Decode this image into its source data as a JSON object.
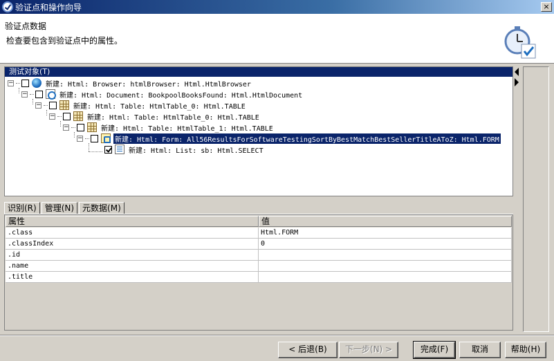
{
  "window": {
    "title": "验证点和操作向导",
    "close_label": "×"
  },
  "header": {
    "title": "验证点数据",
    "description": "检查要包含到验证点中的属性。",
    "icon": "stopwatch-check-icon"
  },
  "tree": {
    "header": "测试对象(T)",
    "nodes": [
      {
        "label": "新建: Html: Browser: htmlBrowser: Html.HtmlBrowser",
        "icon": "globe-icon",
        "checked": false,
        "selected": false
      },
      {
        "label": "新建: Html: Document: BookpoolBooksFound: Html.HtmlDocument",
        "icon": "document-icon",
        "checked": false,
        "selected": false
      },
      {
        "label": "新建: Html: Table: HtmlTable_0: Html.TABLE",
        "icon": "table-icon",
        "checked": false,
        "selected": false
      },
      {
        "label": "新建: Html: Table: HtmlTable_0: Html.TABLE",
        "icon": "table-icon",
        "checked": false,
        "selected": false
      },
      {
        "label": "新建: Html: Table: HtmlTable_1: Html.TABLE",
        "icon": "table-icon",
        "checked": false,
        "selected": false
      },
      {
        "label": "新建: Html: Form: All56ResultsForSoftwareTestingSortByBestMatchBestSellerTitleAToZ: Html.FORM",
        "icon": "form-icon",
        "checked": false,
        "selected": true
      },
      {
        "label": "新建: Html: List: sb: Html.SELECT",
        "icon": "list-icon",
        "checked": true,
        "selected": false
      }
    ]
  },
  "tabs": [
    {
      "label": "识别(R)",
      "active": true
    },
    {
      "label": "管理(N)",
      "active": false
    },
    {
      "label": "元数据(M)",
      "active": false
    }
  ],
  "properties": {
    "columns": [
      "属性",
      "值"
    ],
    "rows": [
      {
        "name": ".class",
        "value": "Html.FORM"
      },
      {
        "name": ".classIndex",
        "value": "0"
      },
      {
        "name": ".id",
        "value": ""
      },
      {
        "name": ".name",
        "value": ""
      },
      {
        "name": ".title",
        "value": ""
      }
    ]
  },
  "buttons": {
    "back": "< 后退(B)",
    "next": "下一步(N) >",
    "finish": "完成(F)",
    "cancel": "取消",
    "help": "帮助(H)"
  }
}
